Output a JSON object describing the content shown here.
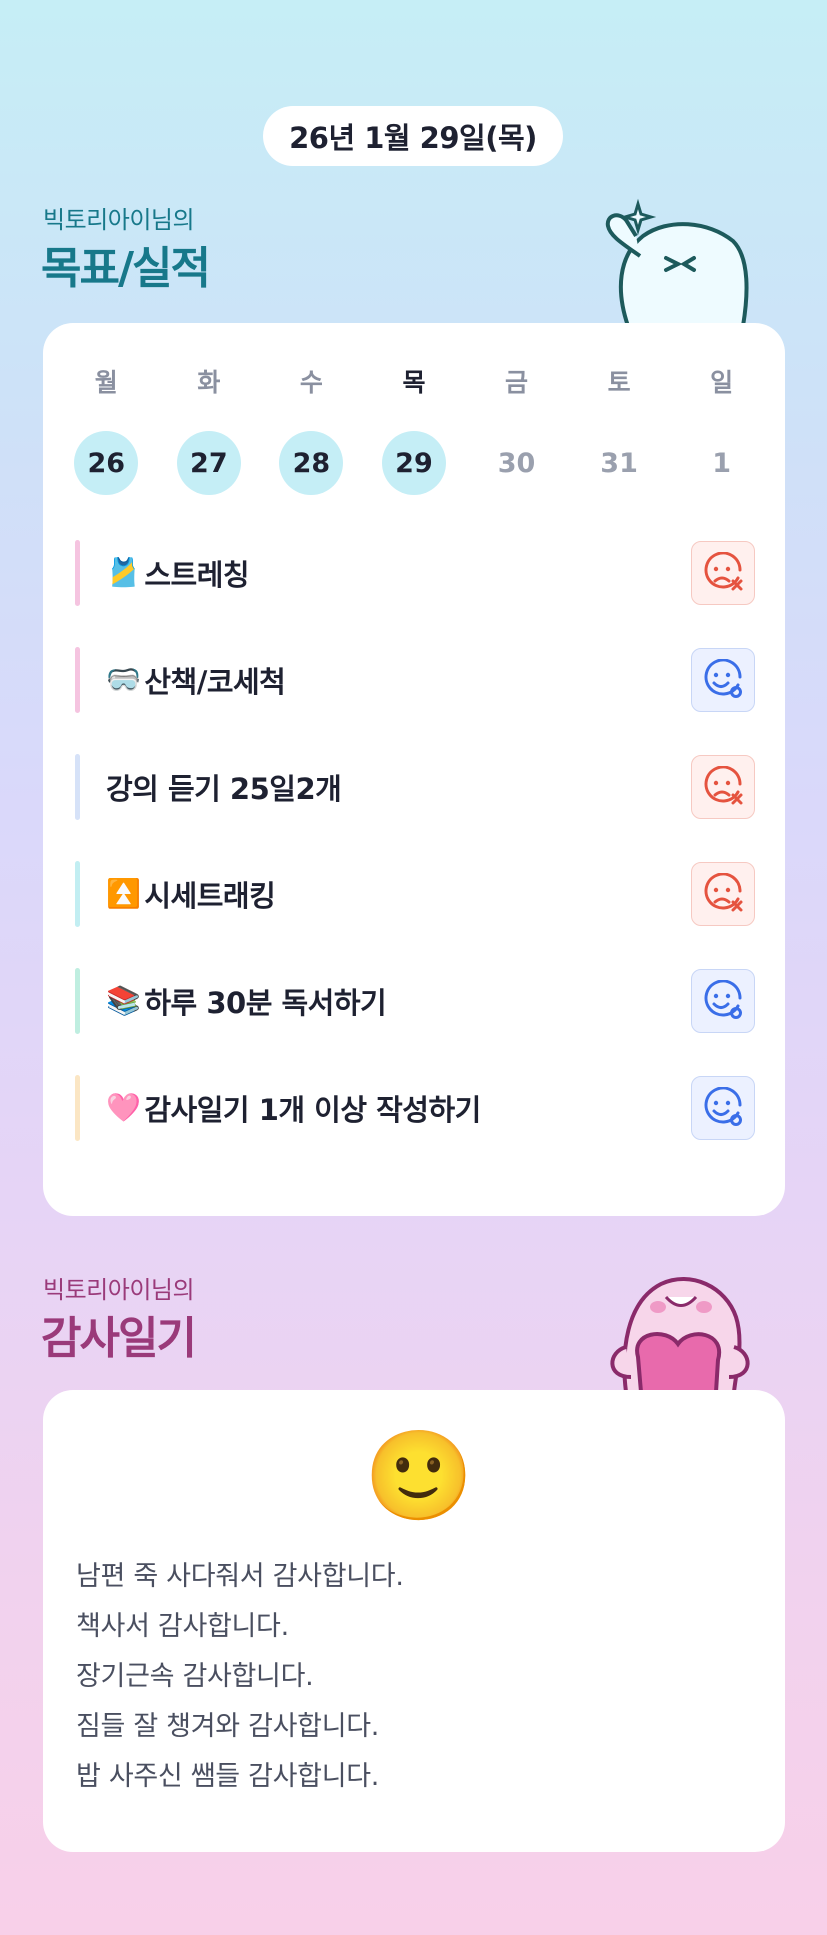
{
  "header": {
    "date": "26년 1월 29일(목)"
  },
  "goals_section": {
    "subtitle": "빅토리아이님의",
    "title": "목표/실적"
  },
  "week": {
    "days": [
      {
        "label": "월",
        "date": "26",
        "state": "done"
      },
      {
        "label": "화",
        "date": "27",
        "state": "done"
      },
      {
        "label": "수",
        "date": "28",
        "state": "done"
      },
      {
        "label": "목",
        "date": "29",
        "state": "today"
      },
      {
        "label": "금",
        "date": "30",
        "state": "future"
      },
      {
        "label": "토",
        "date": "31",
        "state": "future"
      },
      {
        "label": "일",
        "date": "1",
        "state": "future"
      }
    ]
  },
  "goals": [
    {
      "emoji": "🎽",
      "label": "스트레칭",
      "bar_color": "#f5c4e0",
      "result": "sad-face-x-icon"
    },
    {
      "emoji": "🥽",
      "label": "산책/코세척",
      "bar_color": "#f5c4e0",
      "result": "smile-face-o-icon"
    },
    {
      "emoji": "",
      "label": "강의 듣기 25일2개",
      "bar_color": "#d6e2f8",
      "result": "sad-face-x-icon"
    },
    {
      "emoji": "⏫",
      "label": "시세트래킹",
      "bar_color": "#c2eef2",
      "result": "sad-face-x-icon"
    },
    {
      "emoji": "📚",
      "label": " 하루 30분 독서하기",
      "bar_color": "#bfeee0",
      "result": "smile-face-o-icon"
    },
    {
      "emoji": "🩷",
      "label": " 감사일기 1개 이상 작성하기",
      "bar_color": "#fbe6c4",
      "result": "smile-face-o-icon"
    }
  ],
  "gratitude_section": {
    "subtitle": "빅토리아이님의",
    "title": "감사일기"
  },
  "gratitude": {
    "mood_emoji": "🙂",
    "lines": [
      "남편  죽 사다줘서 감사합니다.",
      "책사서 감사합니다.",
      "장기근속 감사합니다.",
      "짐들 잘 챙겨와 감사합니다.",
      "밥 사주신 쌤들 감사합니다."
    ]
  },
  "colors": {
    "bad": "#e5533f",
    "good": "#3a6ee8",
    "teal_title": "#17788a",
    "plum_title": "#9a3a7a"
  }
}
